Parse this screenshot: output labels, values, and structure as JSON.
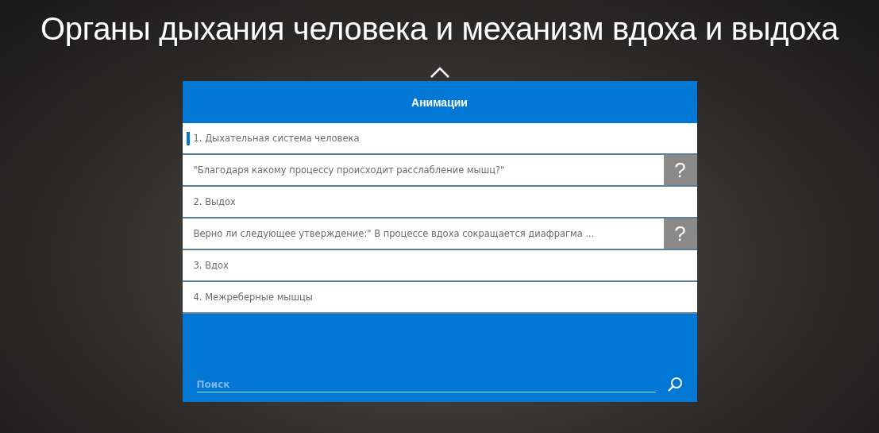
{
  "title": "Органы дыхания человека и механизм вдоха и выдоха",
  "panel": {
    "title": "Анимации",
    "items": [
      {
        "kind": "item",
        "label": "1. Дыхательная система человека",
        "selected": true
      },
      {
        "kind": "question",
        "label": "\"Благодаря какому процессу происходит расслабление мышц?\"",
        "button": "?",
        "selected": false
      },
      {
        "kind": "item",
        "label": "2. Выдох",
        "selected": false
      },
      {
        "kind": "question",
        "label": "Верно ли следующее утверждение:\" В процессе вдоха сокращается диафрагма ...",
        "button": "?",
        "selected": false
      },
      {
        "kind": "item",
        "label": "3. Вдох",
        "selected": false
      },
      {
        "kind": "item",
        "label": "4. Межреберные мышцы",
        "selected": false
      }
    ],
    "search": {
      "placeholder": "Поиск"
    }
  }
}
